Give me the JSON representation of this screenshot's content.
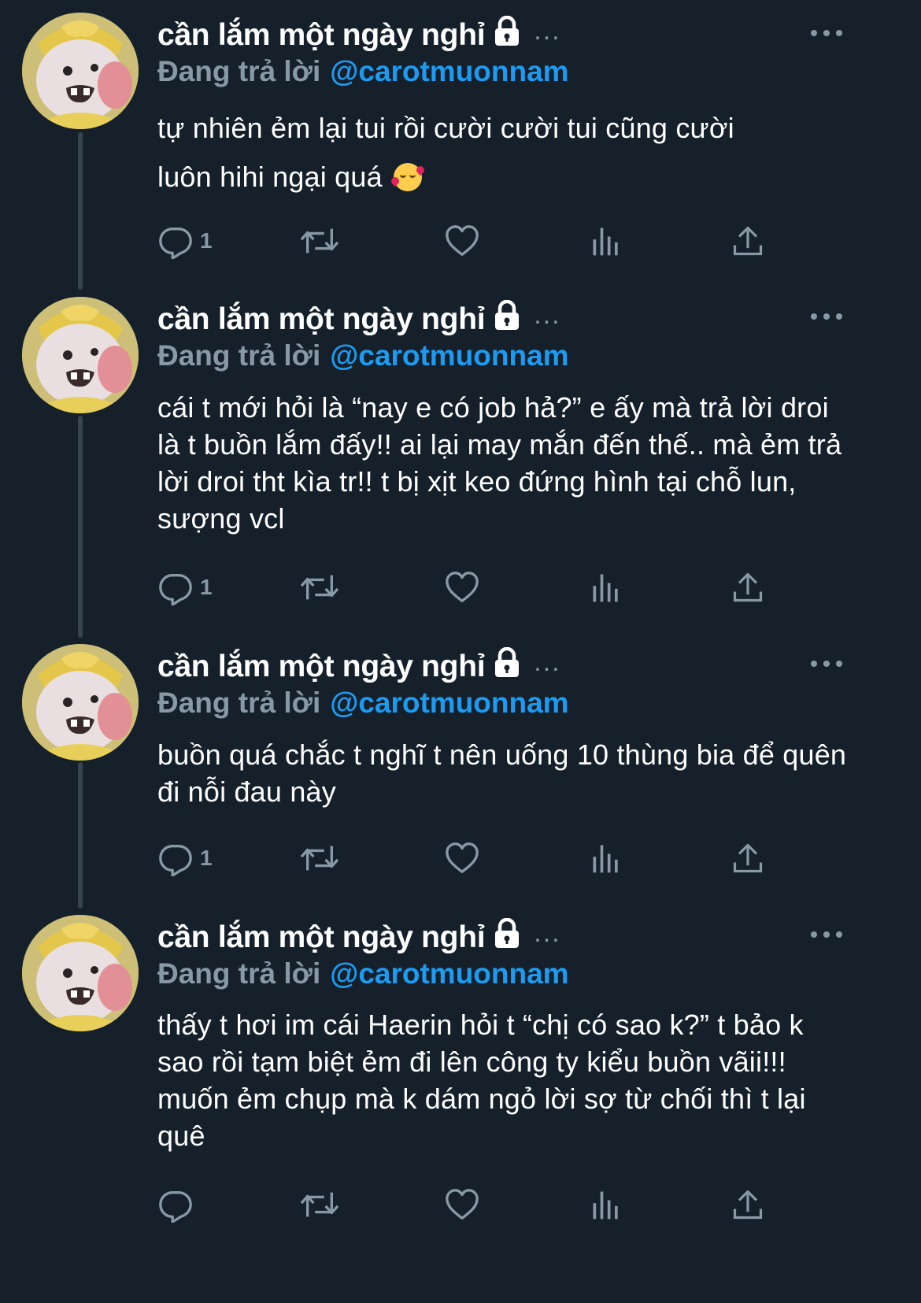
{
  "tweets": [
    {
      "author": "cần lắm một ngày nghỉ",
      "reply_label": "Đang trả lời",
      "reply_handle": "@carotmuonnam",
      "text_line1": "tự nhiên ẻm lại tui rồi cười cười tui cũng cười",
      "text_line2": "luôn hihi ngại quá",
      "emoji": "smiling-face-with-hearts",
      "reply_count": "1"
    },
    {
      "author": "cần lắm một ngày nghỉ",
      "reply_label": "Đang trả lời",
      "reply_handle": "@carotmuonnam",
      "text": "cái t mới hỏi là “nay e có job hả?” e ấy mà trả lời droi là t buồn lắm đấy!! ai lại may mắn đến thế.. mà ẻm trả lời droi tht kìa tr!! t bị xịt keo đứng hình tại chỗ lun, sượng vcl",
      "reply_count": "1"
    },
    {
      "author": "cần lắm một ngày nghỉ",
      "reply_label": "Đang trả lời",
      "reply_handle": "@carotmuonnam",
      "text": "buồn quá chắc t nghĩ t nên uống 10 thùng bia để quên đi nỗi đau này",
      "reply_count": "1"
    },
    {
      "author": "cần lắm một ngày nghỉ",
      "reply_label": "Đang trả lời",
      "reply_handle": "@carotmuonnam",
      "text": "thấy t hơi im cái Haerin hỏi t “chị có sao k?” t bảo k sao rồi tạm biệt ẻm đi lên công ty kiểu buồn vãii!!! muốn ẻm chụp mà k dám ngỏ lời sợ từ chối thì t lại quê",
      "reply_count": ""
    }
  ],
  "icons": {
    "reply": "reply-icon",
    "retweet": "retweet-icon",
    "like": "heart-icon",
    "views": "analytics-icon",
    "share": "share-icon",
    "protected": "lock-icon",
    "more": "more-icon"
  },
  "colors": {
    "background": "#15202b",
    "secondary_text": "#8899a6",
    "link": "#1d9bf0",
    "thread_line": "#38444d"
  }
}
